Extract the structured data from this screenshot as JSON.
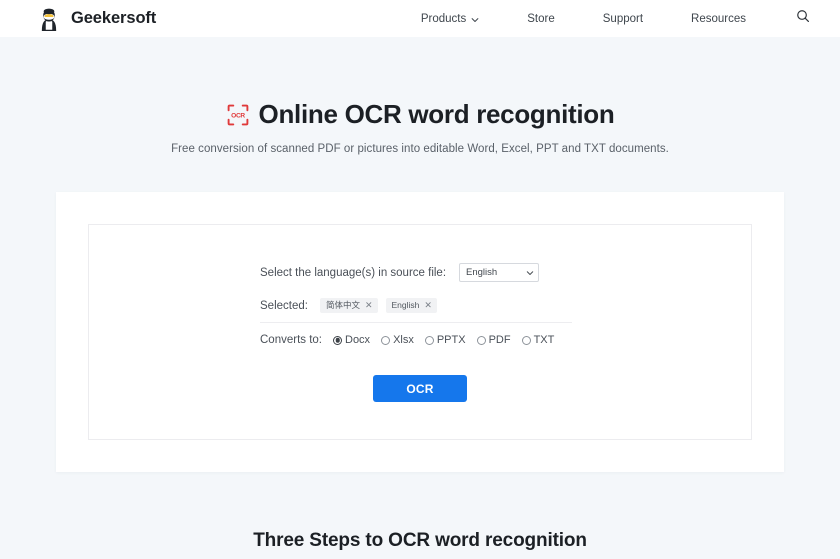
{
  "header": {
    "brand_name": "Geekersoft",
    "logo_icon": "geekersoft-mascot-icon",
    "nav": [
      {
        "label": "Products",
        "has_chevron": true,
        "icon": "chevron-down-icon"
      },
      {
        "label": "Store",
        "has_chevron": false
      },
      {
        "label": "Support",
        "has_chevron": false
      },
      {
        "label": "Resources",
        "has_chevron": false
      }
    ],
    "search_icon": "search-icon"
  },
  "hero": {
    "badge_icon": "ocr-scan-frame-icon",
    "badge_text": "OCR",
    "title": "Online OCR word recognition",
    "subtitle": "Free conversion of scanned PDF or pictures into editable Word, Excel, PPT and TXT documents."
  },
  "form": {
    "language_label": "Select the language(s) in source file:",
    "language_selected": "English",
    "language_chevron_icon": "chevron-down-icon",
    "selected_label": "Selected:",
    "selected_tags": [
      {
        "label": "简体中文",
        "remove_icon": "close-icon",
        "remove_glyph": "✕"
      },
      {
        "label": "English",
        "remove_icon": "close-icon",
        "remove_glyph": "✕"
      }
    ],
    "converts_label": "Converts to:",
    "format_options": [
      {
        "label": "Docx",
        "checked": true
      },
      {
        "label": "Xlsx",
        "checked": false
      },
      {
        "label": "PPTX",
        "checked": false
      },
      {
        "label": "PDF",
        "checked": false
      },
      {
        "label": "TXT",
        "checked": false
      }
    ],
    "submit_label": "OCR"
  },
  "bottom": {
    "steps_title": "Three Steps to OCR word recognition"
  },
  "colors": {
    "page_bg": "#f4f7fa",
    "header_bg": "#ffffff",
    "accent_blue": "#1577ec",
    "ocr_badge_red": "#e03a3a",
    "text_primary": "#1c2025",
    "text_muted": "#5a6169"
  }
}
